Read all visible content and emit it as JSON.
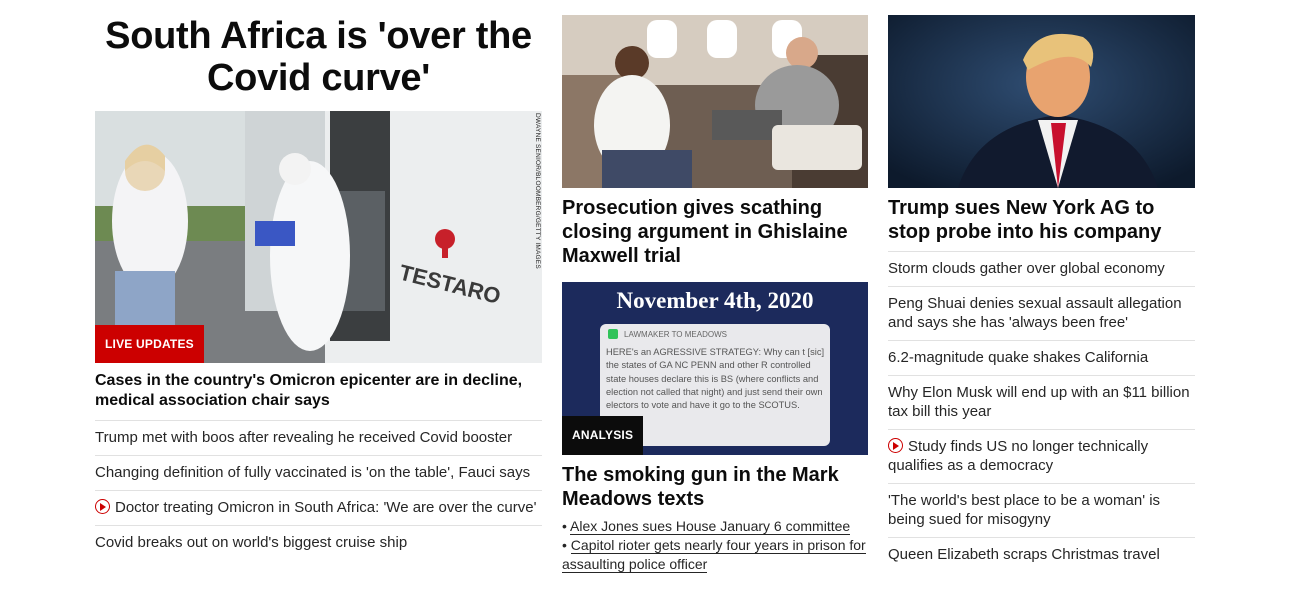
{
  "column1": {
    "hero_title": "South Africa is 'over the Covid curve'",
    "image_credit": "DWAYNE SENIOR/BLOOMBERG/GETTY IMAGES",
    "image_sign_text": "TESTARO",
    "badge": "LIVE UPDATES",
    "lead_headline": "Cases in the country's Omicron epicenter are in decline, medical association chair says",
    "links": [
      {
        "text": "Trump met with boos after revealing he received Covid booster",
        "video": false
      },
      {
        "text": "Changing definition of fully vaccinated is 'on the table', Fauci says",
        "video": false
      },
      {
        "text": "Doctor treating Omicron in South Africa: 'We are over the curve'",
        "video": true
      },
      {
        "text": "Covid breaks out on world's biggest cruise ship",
        "video": false
      }
    ]
  },
  "column2": {
    "story1_headline": "Prosecution gives scathing closing argument in Ghislaine Maxwell trial",
    "story2": {
      "image_date": "November 4th, 2020",
      "image_msg_header": "LAWMAKER TO MEADOWS",
      "image_msg_body": "HERE's an AGRESSIVE STRATEGY: Why can t [sic] the states of GA NC PENN and other R controlled state houses declare this is BS (where conflicts and election not called that night) and just send their own electors to vote and have it go to the SCOTUS.",
      "badge": "ANALYSIS",
      "headline": "The smoking gun in the Mark Meadows texts",
      "bullets": [
        "Alex Jones sues House January 6 committee",
        "Capitol rioter gets nearly four years in prison for assaulting police officer"
      ]
    }
  },
  "column3": {
    "headline": "Trump sues New York AG to stop probe into his company",
    "links": [
      {
        "text": "Storm clouds gather over global economy",
        "video": false
      },
      {
        "text": "Peng Shuai denies sexual assault allegation and says she has 'always been free'",
        "video": false
      },
      {
        "text": "6.2-magnitude quake shakes California",
        "video": false
      },
      {
        "text": "Why Elon Musk will end up with an $11 billion tax bill this year",
        "video": false
      },
      {
        "text": "Study finds US no longer technically qualifies as a democracy",
        "video": true
      },
      {
        "text": "'The world's best place to be a woman' is being sued for misogyny",
        "video": false
      },
      {
        "text": "Queen Elizabeth scraps Christmas travel",
        "video": false
      }
    ]
  },
  "colors": {
    "accent_red": "#cc0000",
    "text": "#0c0c0c",
    "divider": "#e1e1e1"
  }
}
